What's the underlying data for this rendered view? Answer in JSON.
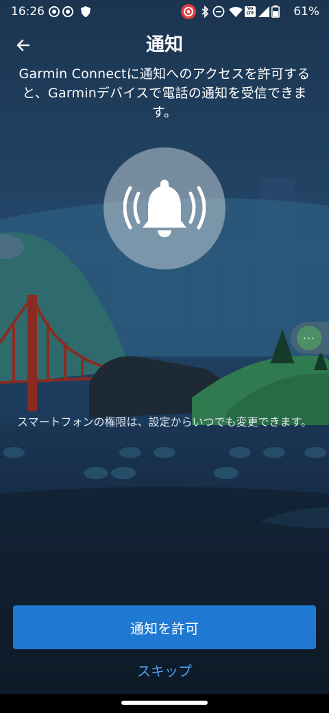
{
  "status_bar": {
    "time": "16:26",
    "battery": "61%",
    "icons": [
      "record-icon",
      "record-icon",
      "shield-icon",
      "record-red-icon",
      "bluetooth-icon",
      "dnd-icon",
      "wifi-icon",
      "volte-icon",
      "signal-icon",
      "battery-icon"
    ],
    "volte_label": "LTE"
  },
  "header": {
    "title": "通知",
    "back_icon": "arrow-left-icon"
  },
  "description": "Garmin Connectに通知へのアクセスを許可すると、Garminデバイスで電話の通知を受信できます。",
  "illustration": {
    "icon": "bell-ringing-icon"
  },
  "floating_bubble": {
    "icon": "more-dots-icon",
    "label": "···"
  },
  "footnote": "スマートフォンの権限は、設定からいつでも変更できます。",
  "actions": {
    "allow_label": "通知を許可",
    "skip_label": "スキップ"
  },
  "colors": {
    "primary_button": "#1f78d1",
    "link": "#4aa0f0",
    "background": "#0f1d2e"
  }
}
